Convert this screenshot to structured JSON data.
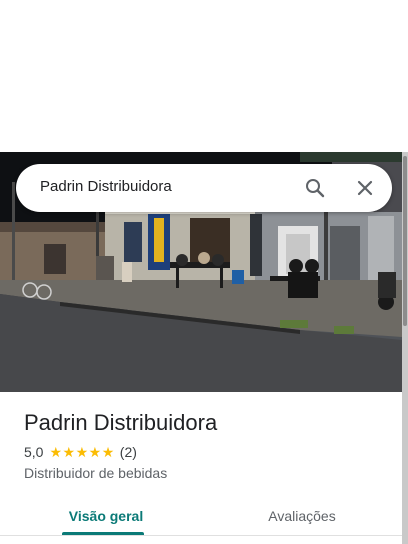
{
  "search": {
    "query": "Padrin Distribuidora"
  },
  "place": {
    "name": "Padrin Distribuidora",
    "rating": "5,0",
    "stars": 5,
    "review_count": "(2)",
    "category": "Distribuidor de bebidas"
  },
  "tabs": [
    {
      "label": "Visão geral",
      "selected": true
    },
    {
      "label": "Avaliações",
      "selected": false
    }
  ],
  "colors": {
    "accent": "#0b7a77",
    "star": "#fbbc04"
  },
  "icons": [
    "search-icon",
    "close-icon",
    "star-icon"
  ]
}
